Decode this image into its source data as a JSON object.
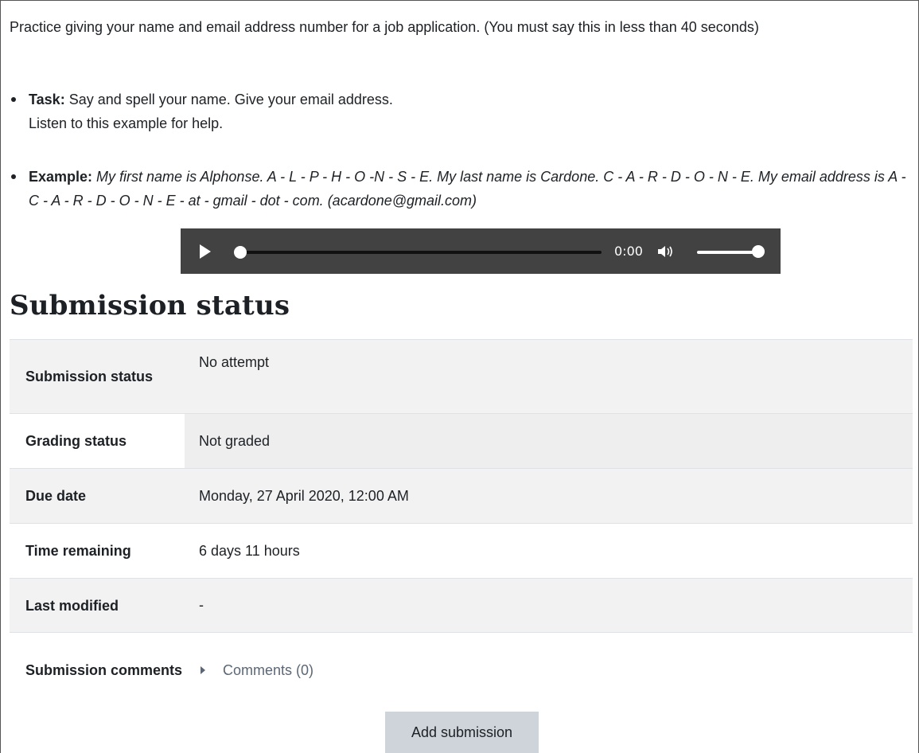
{
  "intro": "Practice giving your name and email address number for a job application.  (You must say this in less than 40 seconds)",
  "task": {
    "label": "Task:",
    "line1": " Say and spell your name. Give your email address.",
    "line2": "Listen to this example for help."
  },
  "example": {
    "label": "Example:",
    "text": " My first name is Alphonse. A - L - P - H - O -N - S - E.  My last name is Cardone. C - A - R - D - O - N - E.  My email address is  A - C - A - R - D - O - N - E - at - gmail - dot - com. (acardone@gmail.com)"
  },
  "audio": {
    "time": "0:00",
    "progress": 0,
    "volume": 1,
    "icons": [
      "play-icon",
      "volume-icon"
    ]
  },
  "section_title": "Submission status",
  "rows": [
    {
      "label": "Submission status",
      "value": "No attempt"
    },
    {
      "label": "Grading status",
      "value": "Not graded"
    },
    {
      "label": "Due date",
      "value": "Monday, 27 April 2020, 12:00 AM"
    },
    {
      "label": "Time remaining",
      "value": "6 days 11 hours"
    },
    {
      "label": "Last modified",
      "value": "-"
    },
    {
      "label": "Submission comments",
      "value": "Comments (0)"
    }
  ],
  "add_submission_label": "Add submission",
  "colors": {
    "player_bg": "#424242",
    "button_bg": "#ced4da",
    "row_shade": "#f2f2f2"
  }
}
